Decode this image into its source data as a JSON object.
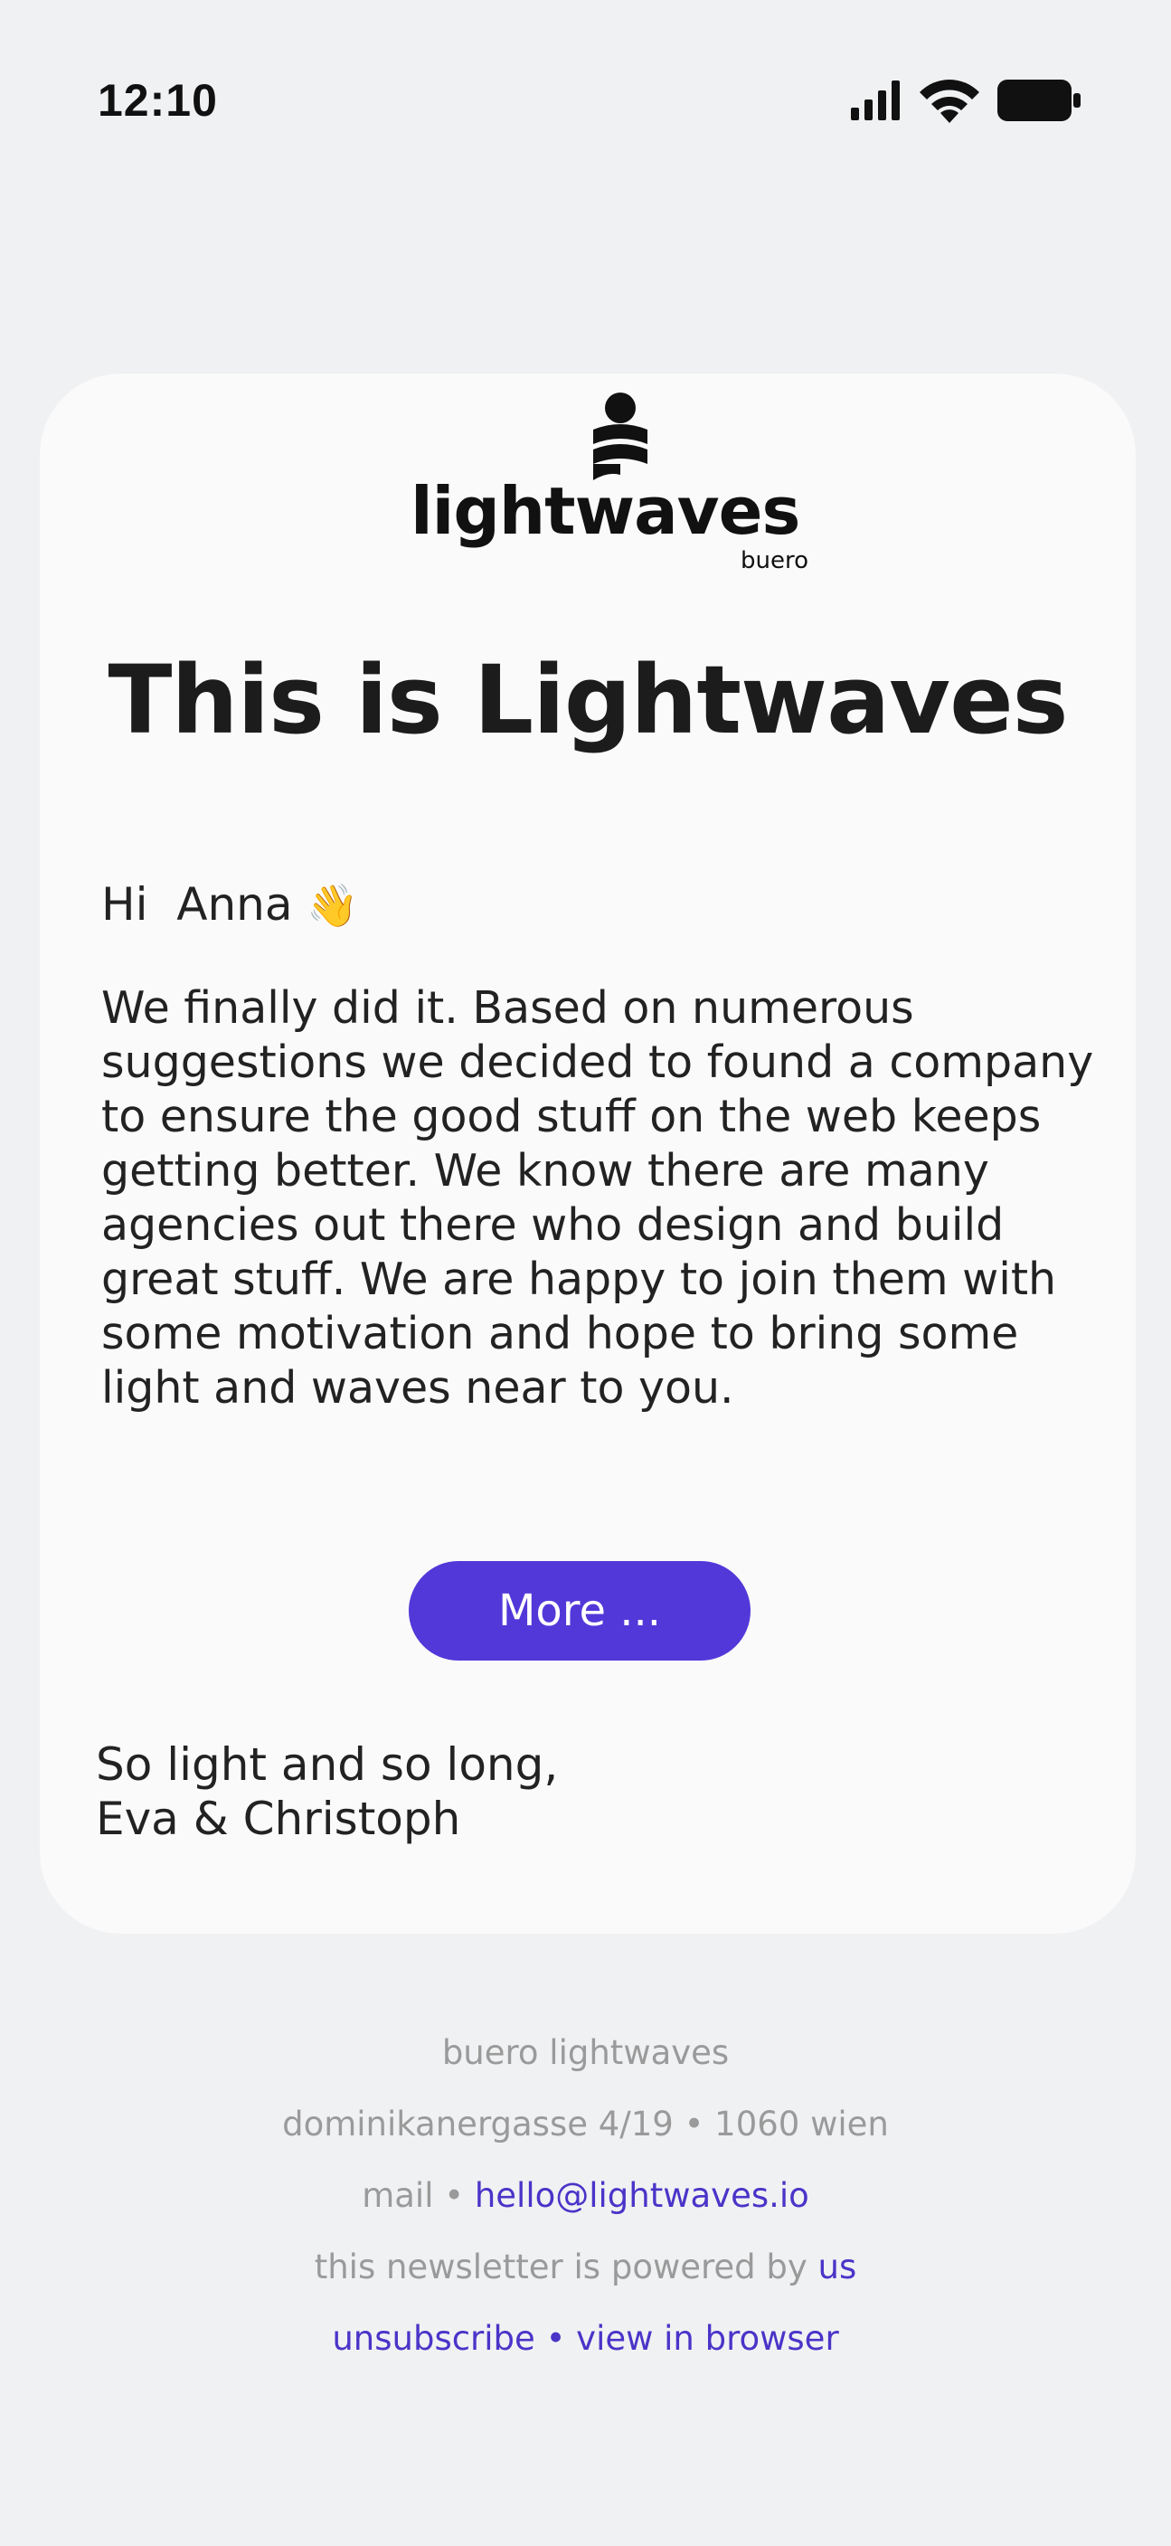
{
  "status_bar": {
    "time": "12:10",
    "icons": [
      "cellular-signal-icon",
      "wifi-icon",
      "battery-icon"
    ]
  },
  "logo": {
    "wordmark": "lightwaves",
    "sub": "buero"
  },
  "email": {
    "headline": "This is Lightwaves",
    "greeting": "Hi  Anna",
    "greeting_emoji": "👋",
    "body": "We finally did it. Based on numerous suggestions we decided to found a company to ensure the good stuff on the web keeps getting better. We know there are many agencies out there who design and build great stuff. We are happy to join them with some motivation and hope to bring some light and waves near to you.",
    "cta_label": "More ...",
    "signoff_line1": "So light and so long,",
    "signoff_line2": "Eva & Christoph"
  },
  "footer": {
    "company": "buero lightwaves",
    "address": "dominikanergasse 4/19 • 1060 wien",
    "mail_prefix": "mail • ",
    "mail_link": "hello@lightwaves.io",
    "powered_prefix": "this newsletter is powered by ",
    "powered_link": "us",
    "unsubscribe": "unsubscribe",
    "separator": " • ",
    "view_in_browser": "view in browser"
  },
  "colors": {
    "background": "#f0f1f3",
    "card": "#fafafa",
    "accent": "#5238d9",
    "link": "#4a34c8",
    "muted": "#9a9a9a"
  }
}
